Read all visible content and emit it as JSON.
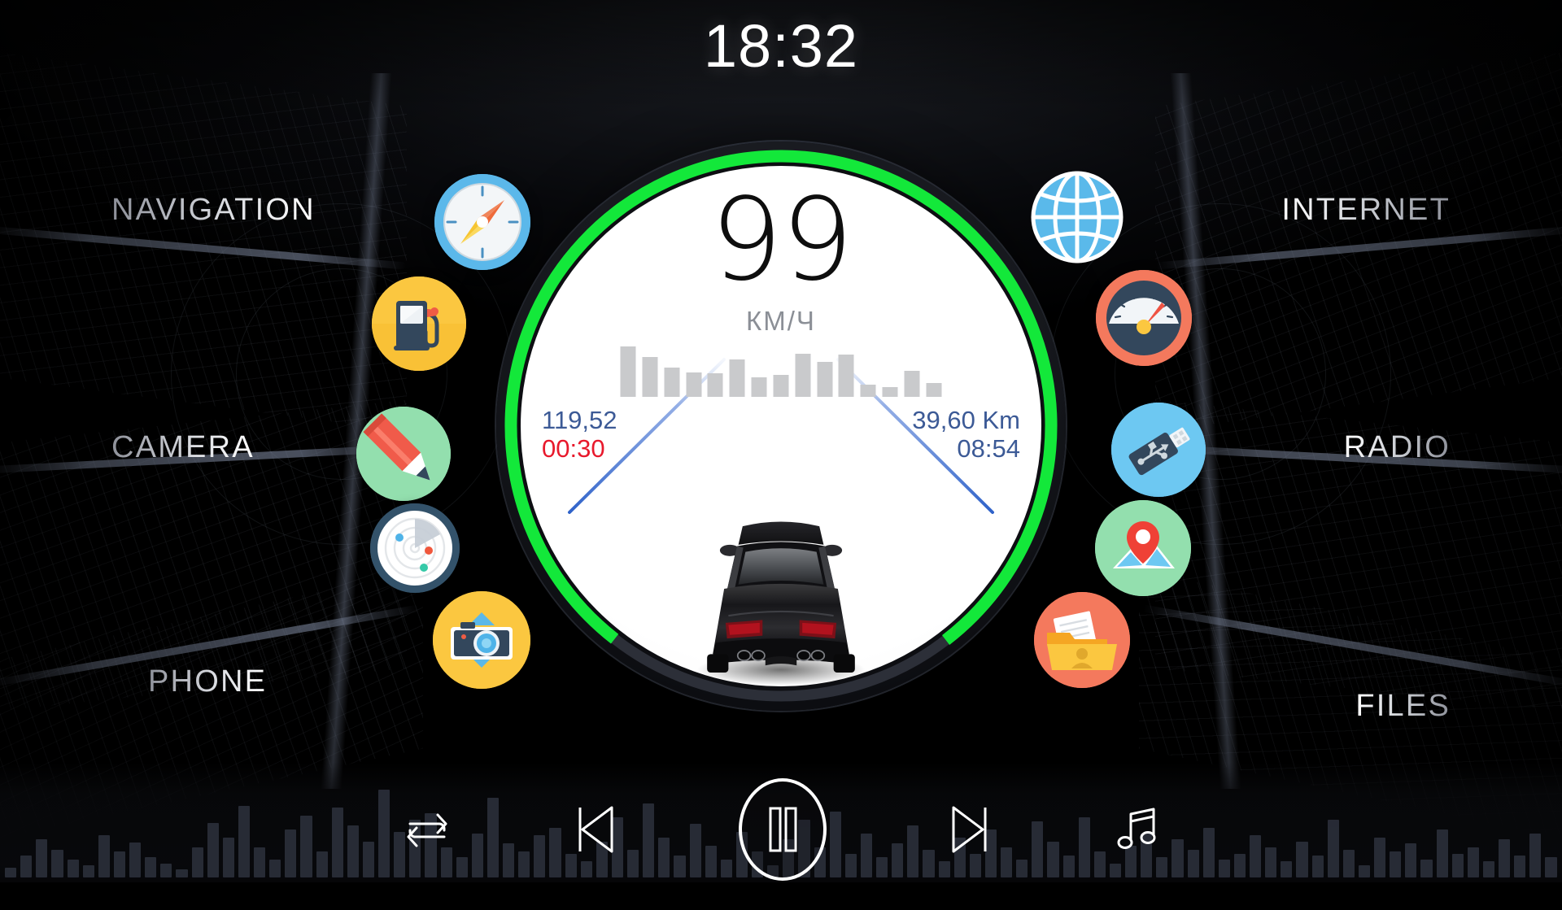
{
  "statusbar": {
    "clock": "18:32"
  },
  "menu": {
    "left": [
      {
        "id": "navigation",
        "label": "NAVIGATION"
      },
      {
        "id": "camera",
        "label": "CAMERA"
      },
      {
        "id": "phone",
        "label": "PHONE"
      }
    ],
    "right": [
      {
        "id": "internet",
        "label": "INTERNET"
      },
      {
        "id": "radio",
        "label": "RADIO"
      },
      {
        "id": "files",
        "label": "FILES"
      }
    ]
  },
  "app_icons": {
    "left_ring": [
      {
        "name": "compass-icon",
        "bg": "#4fb3e8"
      },
      {
        "name": "fuel-pump-icon",
        "bg": "#fbc740"
      },
      {
        "name": "pencil-icon",
        "bg": "#93dfae"
      },
      {
        "name": "radar-icon",
        "bg": "#2f4a5c"
      },
      {
        "name": "camera-icon",
        "bg": "#fbc740"
      }
    ],
    "right_ring": [
      {
        "name": "globe-icon",
        "bg": "#4fb3e8"
      },
      {
        "name": "gauge-icon",
        "bg": "#f47a5e"
      },
      {
        "name": "usb-icon",
        "bg": "#6dc8f2"
      },
      {
        "name": "map-pin-icon",
        "bg": "#93dfae"
      },
      {
        "name": "folder-icon",
        "bg": "#f47a5e"
      }
    ]
  },
  "dashboard": {
    "speed_value": "99",
    "speed_unit": "КМ/Ч",
    "arc_color": "#13e83a",
    "arc_percent": 79,
    "trip_distance": "119,52",
    "trip_time": "00:30",
    "route_distance": "39,60 Km",
    "route_time": "08:54",
    "trip_time_color": "#e8192c",
    "stat_color": "#3c5a96",
    "histogram": [
      58,
      46,
      34,
      28,
      27,
      43,
      22,
      25,
      50,
      40,
      49,
      14,
      11,
      30,
      16
    ]
  },
  "media": {
    "repeat_label": "repeat",
    "previous_label": "previous",
    "play_pause_label": "pause",
    "next_label": "next",
    "playlist_label": "music",
    "equalizer": [
      10,
      22,
      38,
      28,
      18,
      12,
      42,
      26,
      35,
      20,
      14,
      8,
      30,
      55,
      40,
      72,
      30,
      18,
      48,
      62,
      26,
      70,
      52,
      36,
      88,
      46,
      58,
      64,
      30,
      20,
      44,
      80,
      34,
      26,
      42,
      50,
      24,
      16,
      36,
      60,
      28,
      74,
      40,
      22,
      54,
      32,
      18,
      46,
      26,
      12,
      38,
      58,
      30,
      66,
      24,
      44,
      20,
      34,
      52,
      28,
      16,
      40,
      24,
      48,
      30,
      18,
      56,
      36,
      22,
      60,
      26,
      14,
      32,
      44,
      20,
      38,
      28,
      50,
      18,
      24,
      42,
      30,
      16,
      36,
      22,
      58,
      28,
      12,
      40,
      26,
      34,
      18,
      48,
      24,
      30,
      16,
      38,
      22,
      44,
      20
    ]
  }
}
